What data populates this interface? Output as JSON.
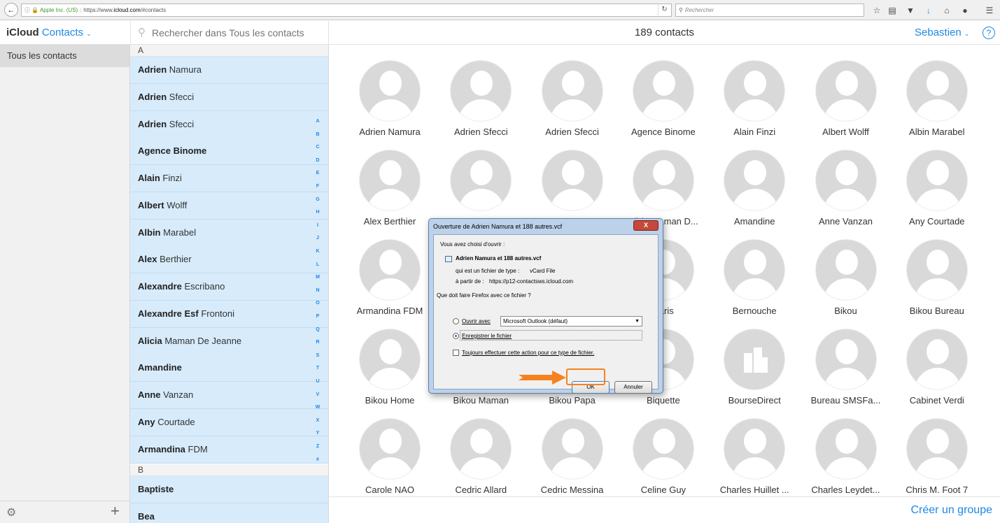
{
  "browser": {
    "back_icon": "back-arrow-icon",
    "url": {
      "org": "Apple Inc. (US)",
      "scheme": "https://www.",
      "host": "icloud.com",
      "path": "/#contacts"
    },
    "search_placeholder": "Rechercher"
  },
  "header": {
    "brand": "iCloud",
    "app": "Contacts",
    "title": "189 contacts",
    "user": "Sebastien",
    "help": "?",
    "search_placeholder": "Rechercher dans Tous les contacts"
  },
  "sidebar": {
    "group": "Tous les contacts",
    "add_label": "+"
  },
  "list": {
    "section_a": "A",
    "section_b": "B",
    "rows": [
      {
        "first": "Adrien",
        "last": "Namura"
      },
      {
        "first": "Adrien",
        "last": "Sfecci"
      },
      {
        "first": "Adrien",
        "last": "Sfecci"
      },
      {
        "first": "Agence Binome",
        "last": ""
      },
      {
        "first": "Alain",
        "last": "Finzi"
      },
      {
        "first": "Albert",
        "last": "Wolff"
      },
      {
        "first": "Albin",
        "last": "Marabel"
      },
      {
        "first": "Alex",
        "last": "Berthier"
      },
      {
        "first": "Alexandre",
        "last": "Escribano"
      },
      {
        "first": "Alexandre Esf",
        "last": "Frontoni"
      },
      {
        "first": "Alicia",
        "last": "Maman De Jeanne"
      },
      {
        "first": "Amandine",
        "last": ""
      },
      {
        "first": "Anne",
        "last": "Vanzan"
      },
      {
        "first": "Any",
        "last": "Courtade"
      },
      {
        "first": "Armandina",
        "last": "FDM"
      }
    ],
    "rows_b": [
      {
        "first": "Baptiste",
        "last": ""
      },
      {
        "first": "Bea",
        "last": ""
      }
    ],
    "index": [
      "A",
      "B",
      "C",
      "D",
      "E",
      "F",
      "G",
      "H",
      "I",
      "J",
      "K",
      "L",
      "M",
      "N",
      "O",
      "P",
      "Q",
      "R",
      "S",
      "T",
      "U",
      "V",
      "W",
      "X",
      "Y",
      "Z",
      "#"
    ]
  },
  "grid": {
    "cards": [
      "Adrien Namura",
      "Adrien Sfecci",
      "Adrien Sfecci",
      "Agence Binome",
      "Alain Finzi",
      "Albert Wolff",
      "Albin Marabel",
      "Alex Berthier",
      "",
      "",
      "Albin Maman D...",
      "Amandine",
      "Anne Vanzan",
      "Any Courtade",
      "Armandina FDM",
      "",
      "",
      "Paris",
      "Bernouche",
      "Bikou",
      "Bikou Bureau",
      "Bikou Home",
      "Bikou Maman",
      "Bikou Papa",
      "Biquette",
      "BourseDirect",
      "Bureau SMSFa...",
      "Cabinet Verdi",
      "Carole NAO",
      "Cedric Allard",
      "Cedric Messina",
      "Celine Guy",
      "Charles Huillet ...",
      "Charles Leydet...",
      "Chris M. Foot 7"
    ],
    "create_group": "Créer un groupe"
  },
  "dialog": {
    "title": "Ouverture de Adrien Namura et 188 autres.vcf",
    "close": "X",
    "chose": "Vous avez choisi d'ouvrir :",
    "filename": "Adrien Namura et 188 autres.vcf",
    "type_label": "qui est un fichier de type :",
    "type_value": "vCard File",
    "from_label": "à partir de :",
    "from_value": "https://p12-contactsws.icloud.com",
    "question": "Que doit faire Firefox avec ce fichier ?",
    "open_with": "Ouvrir avec",
    "app": "Microsoft Outlook (défaut)",
    "save": "Enregistrer le fichier",
    "always": "Toujours effectuer cette action pour ce type de fichier.",
    "ok": "OK",
    "cancel": "Annuler"
  },
  "colors": {
    "accent": "#1e88e5",
    "row_selected": "#d7ebfb",
    "annotation": "#f5821f"
  }
}
